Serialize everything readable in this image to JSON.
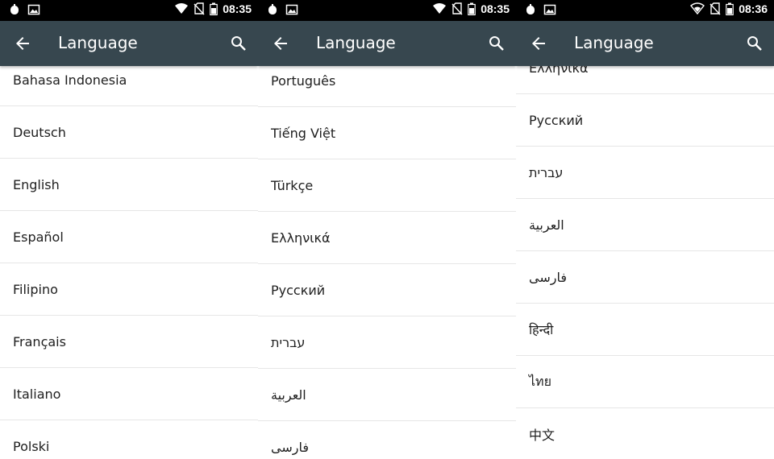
{
  "screens": [
    {
      "status_time": "08:35",
      "title": "Language",
      "languages": [
        "Bahasa Indonesia",
        "Deutsch",
        "English",
        "Español",
        "Filipino",
        "Français",
        "Italiano",
        "Polski"
      ]
    },
    {
      "status_time": "08:35",
      "title": "Language",
      "languages": [
        "Português",
        "Tiếng Việt",
        "Türkçe",
        "Ελληνικά",
        "Русский",
        "עברית",
        "العربية",
        "فارسی"
      ]
    },
    {
      "status_time": "08:36",
      "title": "Language",
      "languages": [
        "Ελληνικά",
        "Русский",
        "עברית",
        "العربية",
        "فارسی",
        "हिन्दी",
        "ไทย",
        "中文"
      ]
    }
  ],
  "colors": {
    "status_bar": "#000000",
    "app_bar": "#37474f",
    "list_background": "#ffffff",
    "divider": "#e6e6e6",
    "text": "#202020"
  },
  "icons": {
    "back": "arrow-back-icon",
    "search": "search-icon",
    "status_left": [
      "notification-icon",
      "gallery-icon"
    ],
    "status_right": [
      "wifi-icon",
      "no-sim-icon",
      "battery-icon"
    ]
  }
}
